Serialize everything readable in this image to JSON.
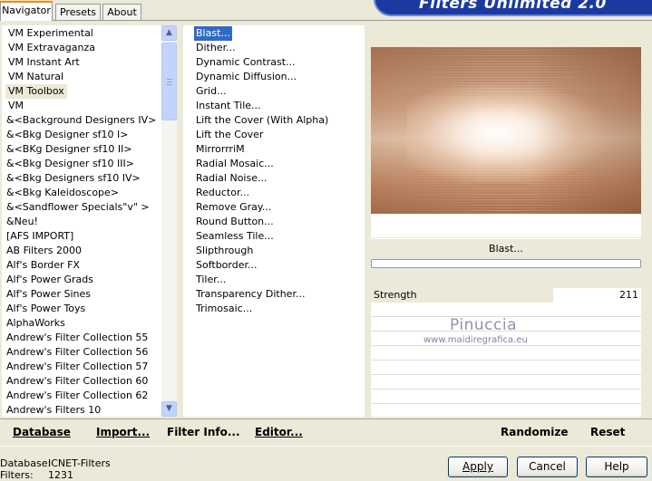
{
  "tabs": [
    {
      "label": "Navigator",
      "active": true
    },
    {
      "label": "Presets",
      "active": false
    },
    {
      "label": "About",
      "active": false
    }
  ],
  "banner": {
    "title": "Filters Unlimited 2.0"
  },
  "categories": [
    "VM Experimental",
    "VM Extravaganza",
    "VM Instant Art",
    "VM Natural",
    "VM Toolbox",
    "VM",
    "&<Background Designers IV>",
    "&<Bkg Designer sf10 I>",
    "&<BKg Designer sf10 II>",
    "&<Bkg Designer sf10 III>",
    "&<Bkg Designers sf10 IV>",
    "&<Bkg Kaleidoscope>",
    "&<Sandflower Specials\"v\" >",
    "&Neu!",
    "[AFS IMPORT]",
    "AB Filters 2000",
    "Alf's Border FX",
    "Alf's Power Grads",
    "Alf's Power Sines",
    "Alf's Power Toys",
    "AlphaWorks",
    "Andrew's Filter Collection 55",
    "Andrew's Filter Collection 56",
    "Andrew's Filter Collection 57",
    "Andrew's Filter Collection 60",
    "Andrew's Filter Collection 62",
    "Andrew's Filters 10"
  ],
  "selected_category": "VM Toolbox",
  "filters": [
    "Blast...",
    "Dither...",
    "Dynamic Contrast...",
    "Dynamic Diffusion...",
    "Grid...",
    "Instant Tile...",
    "Lift the Cover (With Alpha)",
    "Lift the Cover",
    "MirrorrriM",
    "Radial Mosaic...",
    "Radial Noise...",
    "Reductor...",
    "Remove Gray...",
    "Round Button...",
    "Seamless Tile...",
    "Slipthrough",
    "Softborder...",
    "Tiler...",
    "Transparency Dither...",
    "Trimosaic..."
  ],
  "selected_filter": "Blast...",
  "preview": {
    "filter_label": "Blast..."
  },
  "parameters": [
    {
      "name": "Strength",
      "value": "211"
    }
  ],
  "watermark": {
    "name": "Pinuccia",
    "site": "www.maidiregrafica.eu"
  },
  "bottom_buttons": {
    "database": "Database",
    "import": "Import...",
    "filter_info": "Filter Info...",
    "editor": "Editor...",
    "randomize": "Randomize",
    "reset": "Reset"
  },
  "status": {
    "database_label": "Database:",
    "database_value": "ICNET-Filters",
    "filters_label": "Filters:",
    "filters_value": "1231"
  },
  "dialog_buttons": {
    "apply": "Apply",
    "cancel": "Cancel",
    "help": "Help"
  }
}
